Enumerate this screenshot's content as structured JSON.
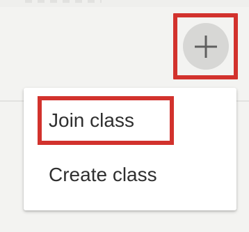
{
  "header": {
    "add_button_icon": "plus-icon"
  },
  "menu": {
    "items": [
      {
        "label": "Join class"
      },
      {
        "label": "Create class"
      }
    ]
  },
  "colors": {
    "highlight": "#d2322d",
    "button_bg": "#d7d7d5",
    "text": "#2f2f2f"
  }
}
